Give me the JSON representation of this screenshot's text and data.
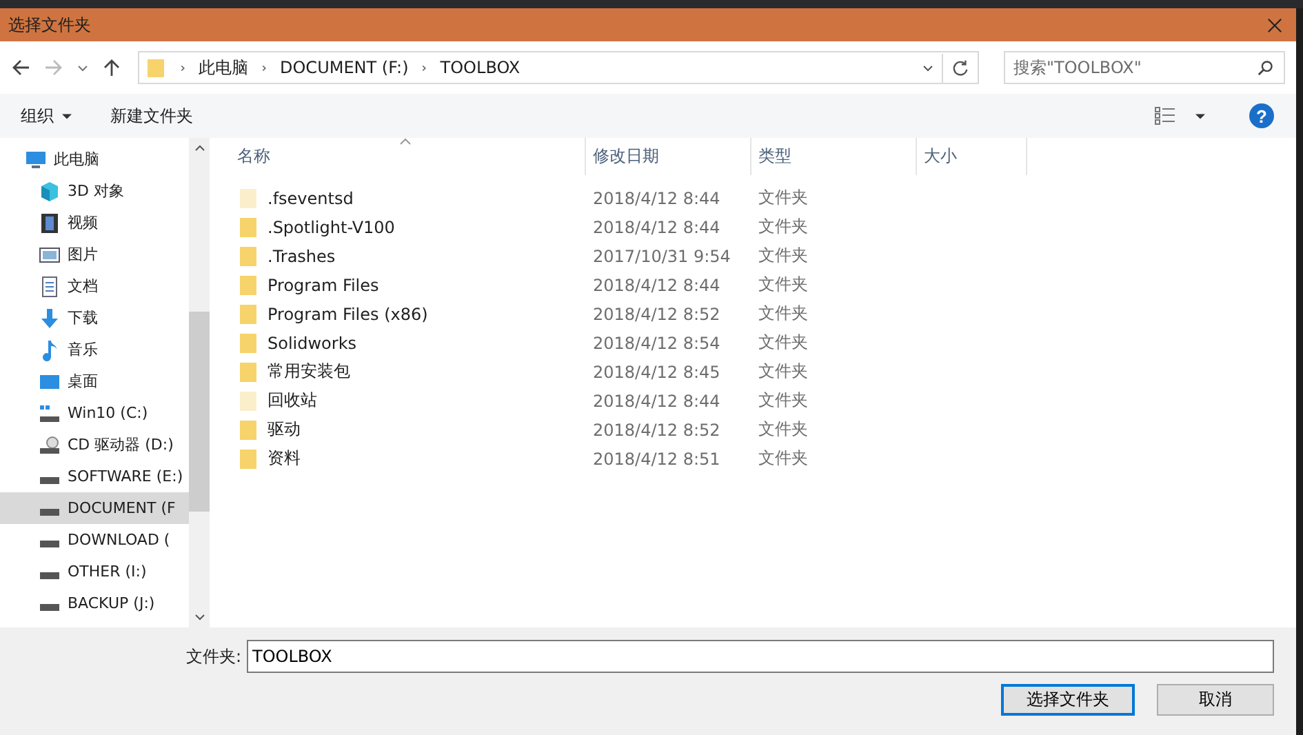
{
  "window": {
    "title": "选择文件夹"
  },
  "address_bar": {
    "path": [
      "此电脑",
      "DOCUMENT (F:)",
      "TOOLBOX"
    ]
  },
  "search": {
    "placeholder": "搜索\"TOOLBOX\""
  },
  "toolbar": {
    "organize": "组织",
    "new_folder": "新建文件夹",
    "help": "?"
  },
  "sidebar": {
    "items": [
      {
        "label": "此电脑",
        "kind": "pc",
        "selected": false,
        "children": [
          {
            "label": "3D 对象",
            "kind": "cube",
            "selected": false
          },
          {
            "label": "视频",
            "kind": "video",
            "selected": false
          },
          {
            "label": "图片",
            "kind": "picture",
            "selected": false
          },
          {
            "label": "文档",
            "kind": "document",
            "selected": false
          },
          {
            "label": "下载",
            "kind": "download",
            "selected": false
          },
          {
            "label": "音乐",
            "kind": "music",
            "selected": false
          },
          {
            "label": "桌面",
            "kind": "desktop",
            "selected": false
          },
          {
            "label": "Win10 (C:)",
            "kind": "system-drive",
            "selected": false
          },
          {
            "label": "CD 驱动器 (D:)",
            "kind": "cd",
            "selected": false
          },
          {
            "label": "SOFTWARE (E:)",
            "kind": "drive",
            "selected": false
          },
          {
            "label": "DOCUMENT (F",
            "kind": "drive",
            "selected": true
          },
          {
            "label": "DOWNLOAD (",
            "kind": "drive",
            "selected": false
          },
          {
            "label": "OTHER (I:)",
            "kind": "drive",
            "selected": false
          },
          {
            "label": "BACKUP (J:)",
            "kind": "drive",
            "selected": false
          }
        ]
      }
    ]
  },
  "table": {
    "columns": [
      "名称",
      "修改日期",
      "类型",
      "大小"
    ],
    "rows": [
      {
        "name": ".fseventsd",
        "date": "2018/4/12 8:44",
        "type": "文件夹",
        "hidden": true
      },
      {
        "name": ".Spotlight-V100",
        "date": "2018/4/12 8:44",
        "type": "文件夹",
        "hidden": false
      },
      {
        "name": ".Trashes",
        "date": "2017/10/31 9:54",
        "type": "文件夹",
        "hidden": false
      },
      {
        "name": "Program Files",
        "date": "2018/4/12 8:44",
        "type": "文件夹",
        "hidden": false
      },
      {
        "name": "Program Files (x86)",
        "date": "2018/4/12 8:52",
        "type": "文件夹",
        "hidden": false
      },
      {
        "name": "Solidworks",
        "date": "2018/4/12 8:54",
        "type": "文件夹",
        "hidden": false
      },
      {
        "name": "常用安装包",
        "date": "2018/4/12 8:45",
        "type": "文件夹",
        "hidden": false
      },
      {
        "name": "回收站",
        "date": "2018/4/12 8:44",
        "type": "文件夹",
        "hidden": true
      },
      {
        "name": "驱动",
        "date": "2018/4/12 8:52",
        "type": "文件夹",
        "hidden": false
      },
      {
        "name": "资料",
        "date": "2018/4/12 8:51",
        "type": "文件夹",
        "hidden": false
      }
    ]
  },
  "folder_field": {
    "label": "文件夹:",
    "value": "TOOLBOX"
  },
  "buttons": [
    {
      "label": "选择文件夹",
      "kind": "primary"
    },
    {
      "label": "取消",
      "kind": "secondary"
    }
  ]
}
